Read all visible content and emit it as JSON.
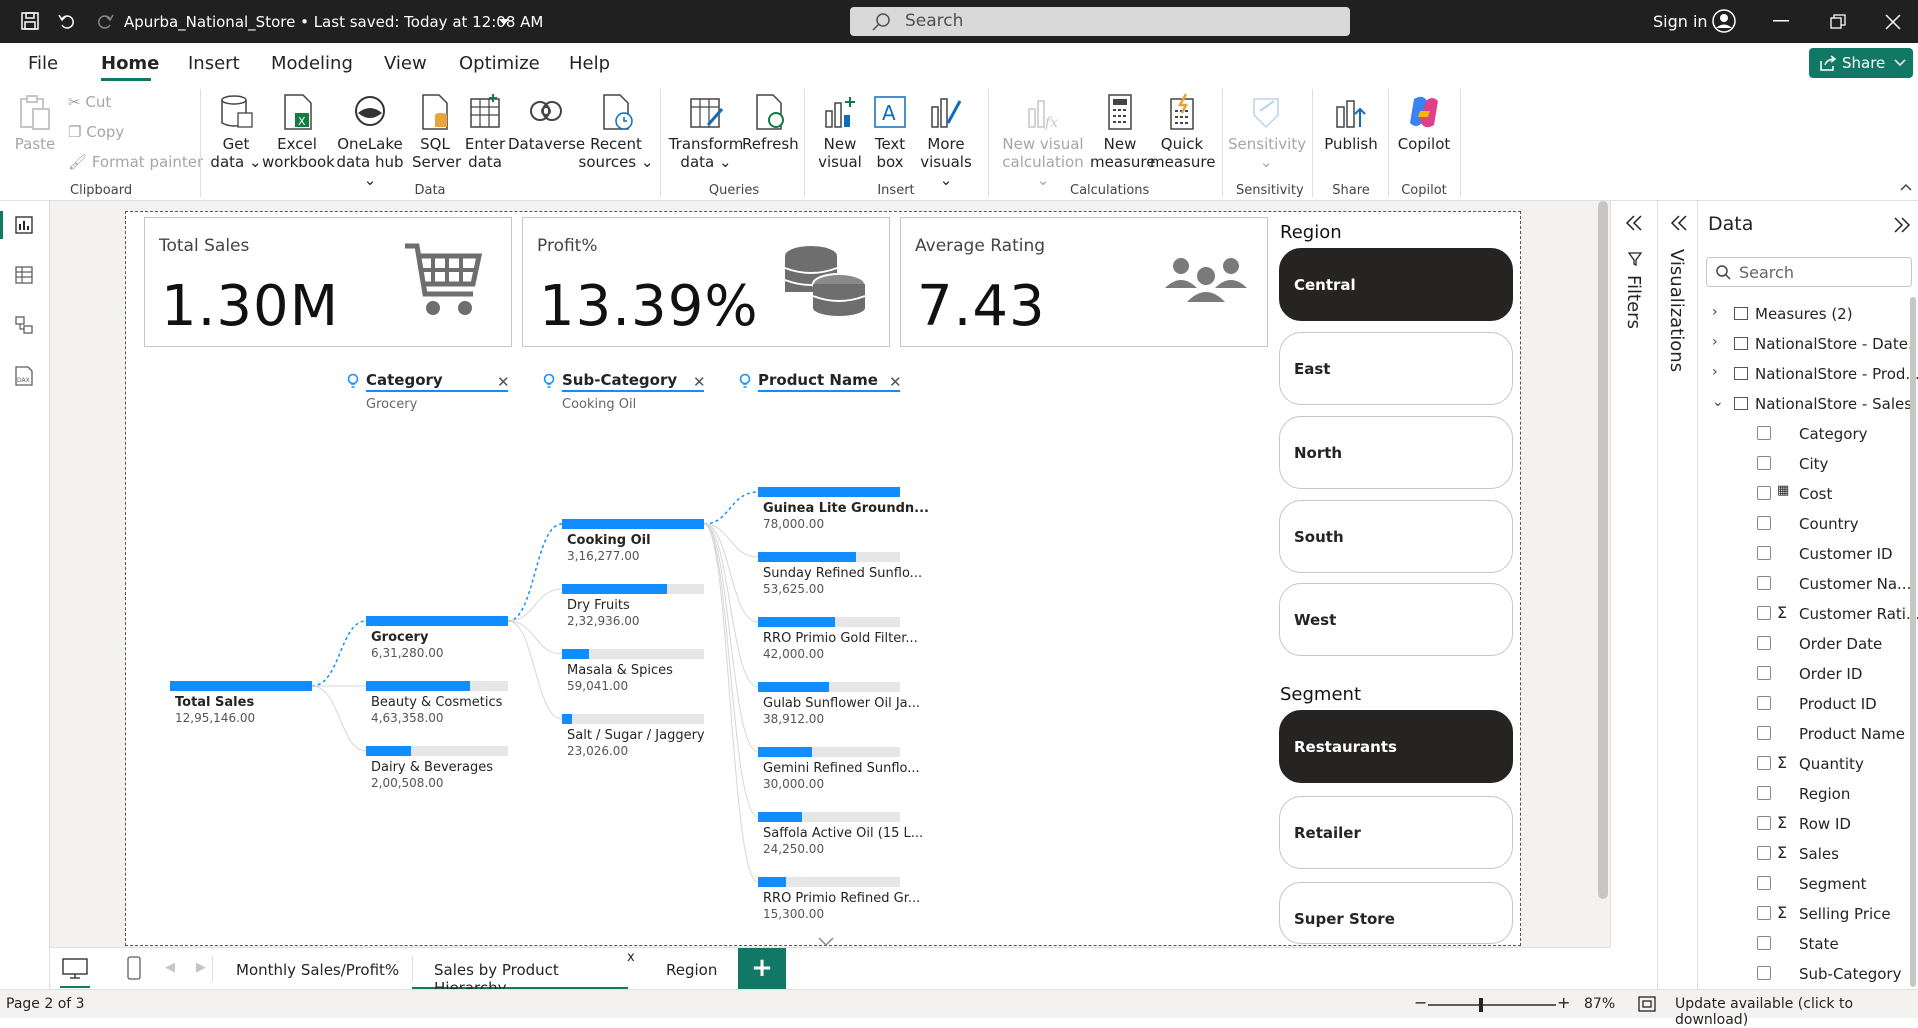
{
  "titlebar": {
    "file_title": "Apurba_National_Store • Last saved: Today at 12:08 AM",
    "search_placeholder": "Search",
    "sign_in": "Sign in"
  },
  "menu": {
    "items": [
      "File",
      "Home",
      "Insert",
      "Modeling",
      "View",
      "Optimize",
      "Help"
    ],
    "active": "Home",
    "share": "Share"
  },
  "ribbon": {
    "clipboard": {
      "paste": "Paste",
      "cut": "Cut",
      "copy": "Copy",
      "format_painter": "Format painter",
      "group": "Clipboard"
    },
    "data": {
      "get_data": "Get data",
      "excel": "Excel workbook",
      "onelake": "OneLake data hub",
      "sql": "SQL Server",
      "enter": "Enter data",
      "dataverse": "Dataverse",
      "recent": "Recent sources",
      "group": "Data"
    },
    "queries": {
      "transform": "Transform data",
      "refresh": "Refresh",
      "group": "Queries"
    },
    "insert": {
      "new_visual": "New visual",
      "text_box": "Text box",
      "more_visuals": "More visuals",
      "group": "Insert"
    },
    "calculations": {
      "new_visual_calc": "New visual calculation",
      "new_measure": "New measure",
      "quick_measure": "Quick measure",
      "group": "Calculations"
    },
    "sensitivity": {
      "label": "Sensitivity",
      "group": "Sensitivity"
    },
    "share": {
      "publish": "Publish",
      "group": "Share"
    },
    "copilot": {
      "label": "Copilot",
      "group": "Copilot"
    }
  },
  "cards": [
    {
      "label": "Total Sales",
      "value": "1.30M",
      "icon": "shopping-cart-icon"
    },
    {
      "label": "Profit%",
      "value": "13.39%",
      "icon": "coins-icon"
    },
    {
      "label": "Average Rating",
      "value": "7.43",
      "icon": "people-icon"
    }
  ],
  "region_slicer": {
    "title": "Region",
    "options": [
      "Central",
      "East",
      "North",
      "South",
      "West"
    ],
    "selected": "Central"
  },
  "segment_slicer": {
    "title": "Segment",
    "options": [
      "Restaurants",
      "Retailer",
      "Super Store"
    ],
    "selected": "Restaurants"
  },
  "decomp_tree": {
    "levels": [
      {
        "header": "Category",
        "selection": "Grocery"
      },
      {
        "header": "Sub-Category",
        "selection": "Cooking Oil"
      },
      {
        "header": "Product Name",
        "selection": ""
      }
    ],
    "root": {
      "label": "Total Sales",
      "value": "12,95,146.00",
      "fill": 1.0
    },
    "categories": [
      {
        "label": "Grocery",
        "value": "6,31,280.00",
        "fill": 1.0,
        "selected": true
      },
      {
        "label": "Beauty & Cosmetics",
        "value": "4,63,358.00",
        "fill": 0.73
      },
      {
        "label": "Dairy & Beverages",
        "value": "2,00,508.00",
        "fill": 0.32
      }
    ],
    "subcategories": [
      {
        "label": "Cooking Oil",
        "value": "3,16,277.00",
        "fill": 1.0,
        "selected": true
      },
      {
        "label": "Dry Fruits",
        "value": "2,32,936.00",
        "fill": 0.74
      },
      {
        "label": "Masala & Spices",
        "value": "59,041.00",
        "fill": 0.19
      },
      {
        "label": "Salt / Sugar / Jaggery",
        "value": "23,026.00",
        "fill": 0.07
      }
    ],
    "products": [
      {
        "label": "Guinea Lite Groundn...",
        "value": "78,000.00",
        "fill": 1.0,
        "bold": true
      },
      {
        "label": "Sunday Refined Sunflo...",
        "value": "53,625.00",
        "fill": 0.69
      },
      {
        "label": "RRO Primio Gold Filter...",
        "value": "42,000.00",
        "fill": 0.54
      },
      {
        "label": "Gulab Sunflower Oil Ja...",
        "value": "38,912.00",
        "fill": 0.5
      },
      {
        "label": "Gemini Refined Sunflo...",
        "value": "30,000.00",
        "fill": 0.38
      },
      {
        "label": "Saffola Active Oil (15 L...",
        "value": "24,250.00",
        "fill": 0.31
      },
      {
        "label": "RRO Primio Refined Gr...",
        "value": "15,300.00",
        "fill": 0.2
      }
    ]
  },
  "panes": {
    "filters": "Filters",
    "visualizations": "Visualizations",
    "data_title": "Data",
    "data_search": "Search",
    "tables": [
      {
        "name": "Measures (2)",
        "expanded": false
      },
      {
        "name": "NationalStore - Date...",
        "expanded": false
      },
      {
        "name": "NationalStore - Prod...",
        "expanded": false
      },
      {
        "name": "NationalStore - Sales...",
        "expanded": true
      }
    ],
    "fields": [
      {
        "name": "Category",
        "sigma": false
      },
      {
        "name": "City",
        "sigma": false
      },
      {
        "name": "Cost",
        "sigma": false,
        "calc": true
      },
      {
        "name": "Country",
        "sigma": false
      },
      {
        "name": "Customer ID",
        "sigma": false
      },
      {
        "name": "Customer Na...",
        "sigma": false
      },
      {
        "name": "Customer Rati...",
        "sigma": true
      },
      {
        "name": "Order Date",
        "sigma": false
      },
      {
        "name": "Order ID",
        "sigma": false
      },
      {
        "name": "Product ID",
        "sigma": false
      },
      {
        "name": "Product Name",
        "sigma": false
      },
      {
        "name": "Quantity",
        "sigma": true
      },
      {
        "name": "Region",
        "sigma": false
      },
      {
        "name": "Row ID",
        "sigma": true
      },
      {
        "name": "Sales",
        "sigma": true
      },
      {
        "name": "Segment",
        "sigma": false
      },
      {
        "name": "Selling Price",
        "sigma": true
      },
      {
        "name": "State",
        "sigma": false
      },
      {
        "name": "Sub-Category",
        "sigma": false
      }
    ]
  },
  "page_tabs": {
    "tabs": [
      "Monthly Sales/Profit%",
      "Sales by Product Hierarchy",
      "Region"
    ],
    "active": "Sales by Product Hierarchy"
  },
  "status": {
    "page": "Page 2 of 3",
    "zoom": "87%",
    "update": "Update available (click to download)"
  },
  "colors": {
    "accent": "#117865",
    "bar": "#118dff",
    "dark": "#252423"
  }
}
